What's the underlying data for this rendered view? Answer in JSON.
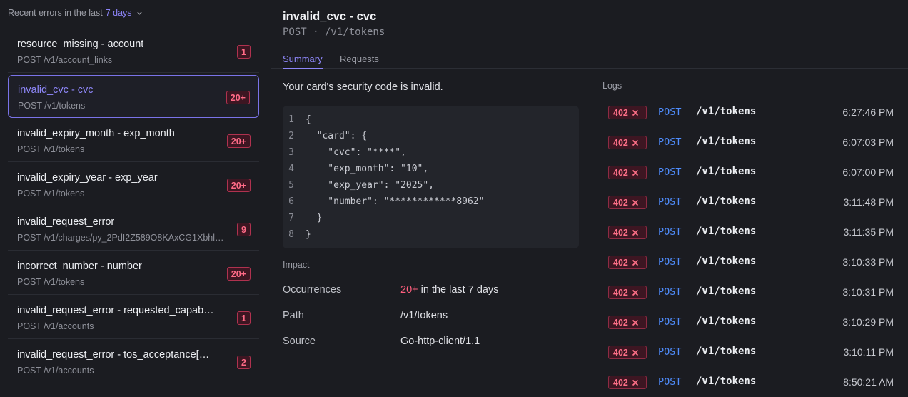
{
  "sidebar": {
    "header_prefix": "Recent errors in the last",
    "header_range": "7 days",
    "items": [
      {
        "title": "resource_missing - account",
        "subtitle": "POST /v1/account_links",
        "count": "1"
      },
      {
        "title": "invalid_cvc - cvc",
        "subtitle": "POST /v1/tokens",
        "count": "20+"
      },
      {
        "title": "invalid_expiry_month - exp_month",
        "subtitle": "POST /v1/tokens",
        "count": "20+"
      },
      {
        "title": "invalid_expiry_year - exp_year",
        "subtitle": "POST /v1/tokens",
        "count": "20+"
      },
      {
        "title": "invalid_request_error",
        "subtitle": "POST /v1/charges/py_2PdI2Z589O8KAxCG1Xbhl…",
        "count": "9"
      },
      {
        "title": "incorrect_number - number",
        "subtitle": "POST /v1/tokens",
        "count": "20+"
      },
      {
        "title": "invalid_request_error - requested_capab…",
        "subtitle": "POST /v1/accounts",
        "count": "1"
      },
      {
        "title": "invalid_request_error - tos_acceptance[…",
        "subtitle": "POST /v1/accounts",
        "count": "2"
      }
    ]
  },
  "detail": {
    "title": "invalid_cvc - cvc",
    "subtitle": "POST · /v1/tokens",
    "tabs": [
      {
        "label": "Summary"
      },
      {
        "label": "Requests"
      }
    ],
    "message": "Your card's security code is invalid.",
    "code_lines": [
      {
        "n": "1",
        "text": "{"
      },
      {
        "n": "2",
        "text": "  \"card\": {"
      },
      {
        "n": "3",
        "text": "    \"cvc\": \"****\","
      },
      {
        "n": "4",
        "text": "    \"exp_month\": \"10\","
      },
      {
        "n": "5",
        "text": "    \"exp_year\": \"2025\","
      },
      {
        "n": "6",
        "text": "    \"number\": \"************8962\""
      },
      {
        "n": "7",
        "text": "  }"
      },
      {
        "n": "8",
        "text": "}"
      }
    ],
    "impact": {
      "label": "Impact",
      "occurrences_label": "Occurrences",
      "occurrences_count": "20+",
      "occurrences_suffix": " in the last 7 days",
      "path_label": "Path",
      "path_value": "/v1/tokens",
      "source_label": "Source",
      "source_value": "Go-http-client/1.1"
    }
  },
  "logs": {
    "label": "Logs",
    "rows": [
      {
        "status": "402",
        "method": "POST",
        "path": "/v1/tokens",
        "time": "6:27:46 PM"
      },
      {
        "status": "402",
        "method": "POST",
        "path": "/v1/tokens",
        "time": "6:07:03 PM"
      },
      {
        "status": "402",
        "method": "POST",
        "path": "/v1/tokens",
        "time": "6:07:00 PM"
      },
      {
        "status": "402",
        "method": "POST",
        "path": "/v1/tokens",
        "time": "3:11:48 PM"
      },
      {
        "status": "402",
        "method": "POST",
        "path": "/v1/tokens",
        "time": "3:11:35 PM"
      },
      {
        "status": "402",
        "method": "POST",
        "path": "/v1/tokens",
        "time": "3:10:33 PM"
      },
      {
        "status": "402",
        "method": "POST",
        "path": "/v1/tokens",
        "time": "3:10:31 PM"
      },
      {
        "status": "402",
        "method": "POST",
        "path": "/v1/tokens",
        "time": "3:10:29 PM"
      },
      {
        "status": "402",
        "method": "POST",
        "path": "/v1/tokens",
        "time": "3:10:11 PM"
      },
      {
        "status": "402",
        "method": "POST",
        "path": "/v1/tokens",
        "time": "8:50:21 AM"
      }
    ]
  },
  "colors": {
    "accent": "#8d86f7",
    "error": "#ff5f7e",
    "method": "#4f8dfd",
    "background": "#1b1c21"
  }
}
